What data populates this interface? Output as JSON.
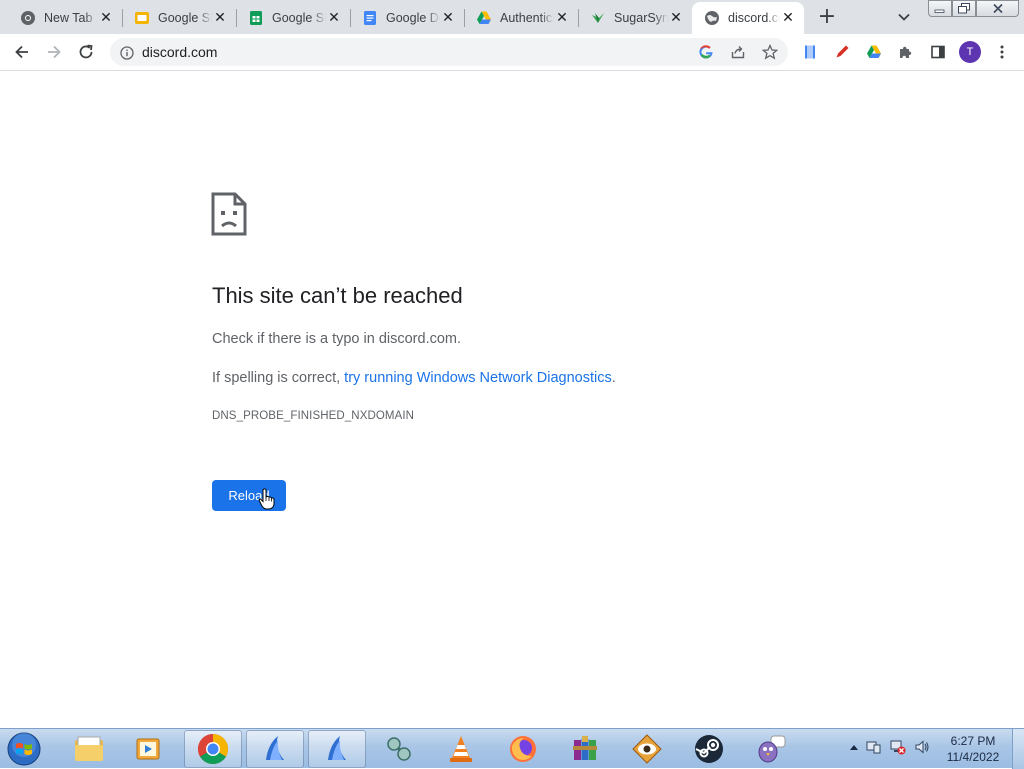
{
  "browser": {
    "tabs": [
      {
        "title": "New Tab",
        "icon": "chrome-icon"
      },
      {
        "title": "Google Slides",
        "icon": "google-slides-icon"
      },
      {
        "title": "Google Sheets",
        "icon": "google-sheets-icon"
      },
      {
        "title": "Google Docs",
        "icon": "google-docs-icon"
      },
      {
        "title": "Authentication",
        "icon": "google-drive-icon"
      },
      {
        "title": "SugarSync",
        "icon": "sugarsync-icon"
      },
      {
        "title": "discord.com",
        "icon": "globe-icon",
        "active": true
      }
    ],
    "address": "discord.com"
  },
  "error_page": {
    "title": "This site can’t be reached",
    "line1": "Check if there is a typo in discord.com.",
    "line2_prefix": "If spelling is correct, ",
    "line2_link": "try running Windows Network Diagnostics",
    "line2_suffix": ".",
    "code": "DNS_PROBE_FINISHED_NXDOMAIN",
    "reload_label": "Reload"
  },
  "taskbar": {
    "time": "6:27 PM",
    "date": "11/4/2022"
  },
  "colors": {
    "accent": "#1a73e8",
    "tabstrip": "#dee1e6",
    "avatar": "#5e35b1"
  },
  "avatar_letter": "T"
}
